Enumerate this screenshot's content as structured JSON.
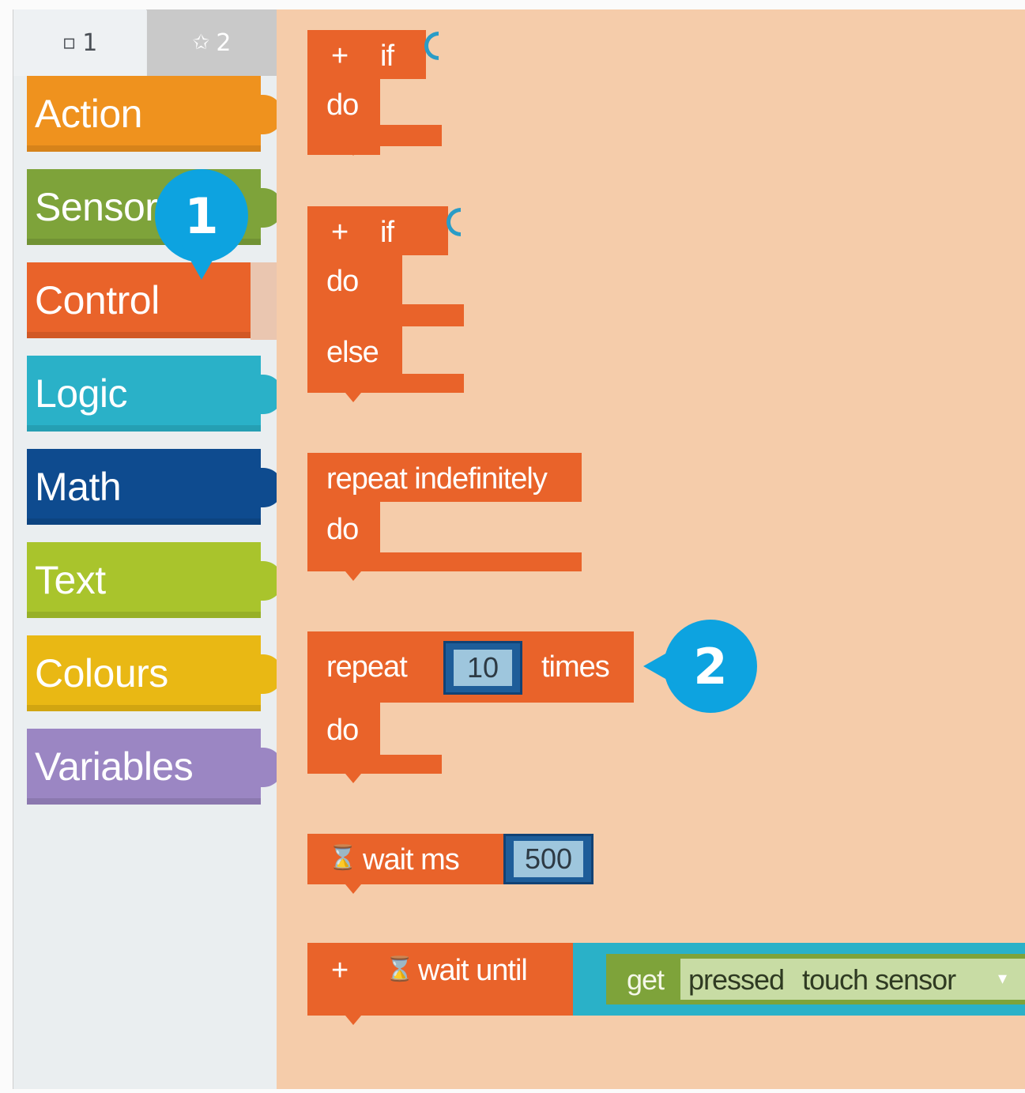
{
  "tabs": [
    {
      "icon": "square-icon",
      "glyph": "▫",
      "label": "1"
    },
    {
      "icon": "star-icon",
      "glyph": "✩",
      "label": "2"
    }
  ],
  "categories": [
    {
      "label": "Action",
      "color": "#ef921e"
    },
    {
      "label": "Sensor",
      "color": "#7ea33a"
    },
    {
      "label": "Control",
      "color": "#e9632a"
    },
    {
      "label": "Logic",
      "color": "#2ab1c8"
    },
    {
      "label": "Math",
      "color": "#0e4b8f"
    },
    {
      "label": "Text",
      "color": "#a9c42c"
    },
    {
      "label": "Colours",
      "color": "#e9b814"
    },
    {
      "label": "Variables",
      "color": "#9b86c3"
    }
  ],
  "blocks": {
    "if": {
      "plus": "+",
      "keyword": "if",
      "do": "do"
    },
    "if_else": {
      "plus": "+",
      "keyword": "if",
      "do": "do",
      "else": "else"
    },
    "repeat_forever": {
      "label": "repeat indefinitely",
      "do": "do"
    },
    "repeat_times": {
      "repeat": "repeat",
      "count": "10",
      "times": "times",
      "do": "do"
    },
    "wait_ms": {
      "hourglass": "⌛",
      "label": "wait ms",
      "value": "500"
    },
    "wait_until": {
      "plus": "+",
      "hourglass": "⌛",
      "label": "wait until",
      "get": "get",
      "mode": "pressed",
      "sensor": "touch sensor",
      "dropdown": "▾"
    }
  },
  "annotations": {
    "badge1": "1",
    "badge2": "2"
  },
  "colors": {
    "control": "#e9632a",
    "workspace": "#f5ccaa",
    "badge": "#0da3e0"
  }
}
